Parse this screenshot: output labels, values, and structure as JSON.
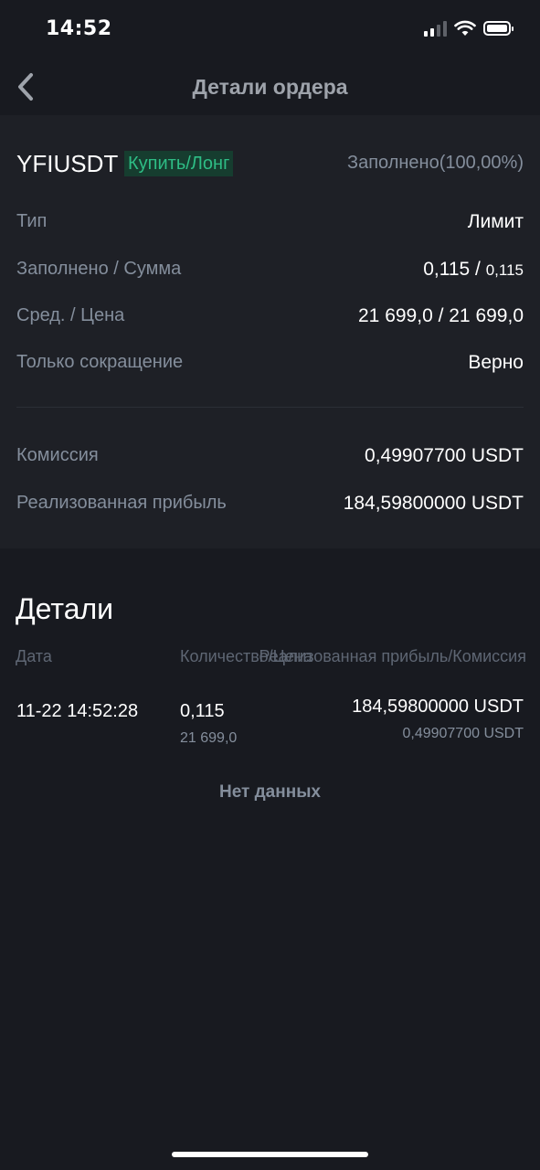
{
  "status_bar": {
    "time": "14:52"
  },
  "nav": {
    "title": "Детали ордера"
  },
  "order": {
    "symbol": "YFIUSDT",
    "side": "Купить/Лонг",
    "fill_status": "Заполнено(100,00%)",
    "type_label": "Тип",
    "type_value": "Лимит",
    "filled_label": "Заполнено / Сумма",
    "filled_value": "0,115 / ",
    "filled_total": "0,115",
    "avg_price_label": "Сред. / Цена",
    "avg_price_value": "21 699,0 / 21 699,0",
    "reduce_only_label": "Только сокращение",
    "reduce_only_value": "Верно",
    "fee_label": "Комиссия",
    "fee_value": "0,49907700 USDT",
    "pnl_label": "Реализованная прибыль",
    "pnl_value": "184,59800000 USDT"
  },
  "details": {
    "title": "Детали",
    "columns": {
      "date": "Дата",
      "qty_price": "Количество/Цена",
      "pnl_fee": "Реализованная прибыль/Комиссия"
    },
    "trades": [
      {
        "date": "11-22 14:52:28",
        "qty": "0,115",
        "price": "21 699,0",
        "pnl": "184,59800000 USDT",
        "fee": "0,49907700 USDT"
      }
    ],
    "no_data": "Нет данных"
  }
}
